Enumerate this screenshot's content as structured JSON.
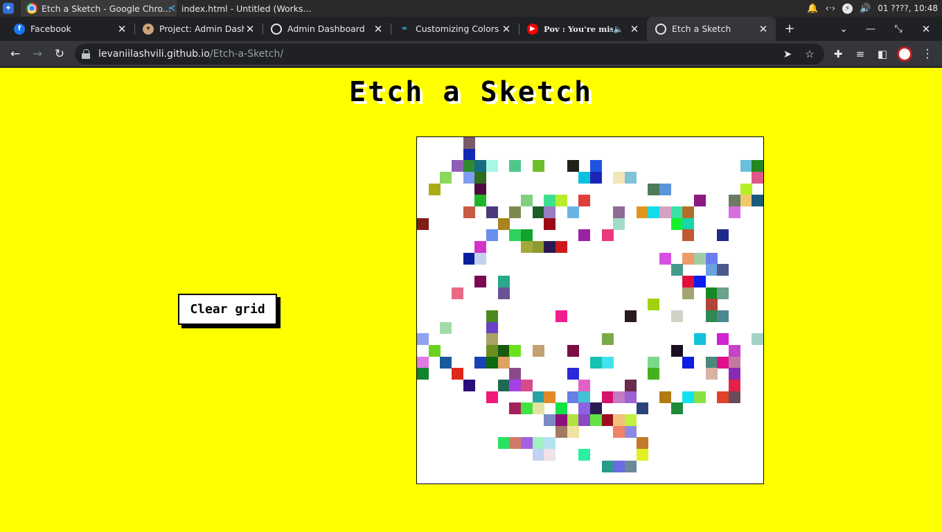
{
  "os": {
    "windows": [
      {
        "title": "Etch a Sketch - Google Chro...",
        "icon": "chrome-icon",
        "active": true
      },
      {
        "title": "index.html - Untitled (Works...",
        "icon": "vscode-icon",
        "active": false
      }
    ],
    "tray": {
      "datetime": "01 ????, 10:48"
    }
  },
  "browser": {
    "tabs": [
      {
        "title": "Facebook",
        "icon": "facebook-icon"
      },
      {
        "title": "Project: Admin Dashb",
        "icon": "project-icon"
      },
      {
        "title": "Admin Dashboard",
        "icon": "globe-icon"
      },
      {
        "title": "Customizing Colors - T",
        "icon": "tailwind-icon"
      },
      {
        "title": "Pov : You're misun",
        "icon": "youtube-icon"
      },
      {
        "title": "Etch a Sketch",
        "icon": "globe-icon",
        "active": true
      }
    ],
    "url": {
      "host": "levaniilashvili.github.io",
      "path": "/Etch-a-Sketch/"
    }
  },
  "page": {
    "title": "Etch a Sketch",
    "clear_button_label": "Clear grid",
    "background_color": "#ffff00",
    "grid": {
      "columns": 30,
      "rows": 30,
      "painted_cells": [
        [
          0,
          4,
          "#7b5a6b"
        ],
        [
          1,
          4,
          "#1328b5"
        ],
        [
          2,
          3,
          "#8e5eb6"
        ],
        [
          2,
          4,
          "#2e8b2f"
        ],
        [
          2,
          5,
          "#156b82"
        ],
        [
          2,
          6,
          "#a8f6e6"
        ],
        [
          2,
          8,
          "#4fc78b"
        ],
        [
          2,
          10,
          "#6dbe2b"
        ],
        [
          2,
          13,
          "#1e2218"
        ],
        [
          2,
          15,
          "#1e52e0"
        ],
        [
          2,
          28,
          "#6ac0da"
        ],
        [
          2,
          29,
          "#26861f"
        ],
        [
          3,
          2,
          "#8cd85d"
        ],
        [
          3,
          4,
          "#7e9cf2"
        ],
        [
          3,
          5,
          "#2e6c1e"
        ],
        [
          3,
          14,
          "#0ec0df"
        ],
        [
          3,
          15,
          "#1b26b6"
        ],
        [
          3,
          17,
          "#f0e6b6"
        ],
        [
          3,
          18,
          "#7ec3d8"
        ],
        [
          3,
          29,
          "#e0588a"
        ],
        [
          4,
          1,
          "#a8ad14"
        ],
        [
          4,
          5,
          "#4c0a41"
        ],
        [
          4,
          20,
          "#4f7a58"
        ],
        [
          4,
          21,
          "#5a95dc"
        ],
        [
          4,
          28,
          "#b6ef24"
        ],
        [
          5,
          5,
          "#1fb52a"
        ],
        [
          5,
          9,
          "#7fd07e"
        ],
        [
          5,
          11,
          "#3de08e"
        ],
        [
          5,
          12,
          "#b7ec2a"
        ],
        [
          5,
          14,
          "#e03e39"
        ],
        [
          5,
          24,
          "#8c1a82"
        ],
        [
          5,
          27,
          "#6a7c62"
        ],
        [
          5,
          28,
          "#f0c86e"
        ],
        [
          5,
          29,
          "#1b5a7c"
        ],
        [
          6,
          4,
          "#c95a44"
        ],
        [
          6,
          6,
          "#4a3a7c"
        ],
        [
          6,
          8,
          "#7c8a4e"
        ],
        [
          6,
          10,
          "#1d5c27"
        ],
        [
          6,
          11,
          "#9a7cc4"
        ],
        [
          6,
          13,
          "#6ab4e4"
        ],
        [
          6,
          17,
          "#8e6c96"
        ],
        [
          6,
          19,
          "#e0961e"
        ],
        [
          6,
          20,
          "#12dce8"
        ],
        [
          6,
          21,
          "#d4a2c2"
        ],
        [
          6,
          22,
          "#3ae0a6"
        ],
        [
          6,
          23,
          "#b06e2a"
        ],
        [
          6,
          27,
          "#d86ee0"
        ],
        [
          7,
          0,
          "#7e1e18"
        ],
        [
          7,
          7,
          "#a8841e"
        ],
        [
          7,
          11,
          "#9a0a12"
        ],
        [
          7,
          17,
          "#a2dcc8"
        ],
        [
          7,
          22,
          "#14f02a"
        ],
        [
          7,
          23,
          "#18d6a8"
        ],
        [
          8,
          6,
          "#6a8ef0"
        ],
        [
          8,
          8,
          "#2ed15c"
        ],
        [
          8,
          9,
          "#12a22e"
        ],
        [
          8,
          14,
          "#9a22a0"
        ],
        [
          8,
          16,
          "#ea3a7c"
        ],
        [
          8,
          23,
          "#c05a34"
        ],
        [
          8,
          26,
          "#1f2a8c"
        ],
        [
          9,
          5,
          "#d035c8"
        ],
        [
          9,
          9,
          "#a2aa36"
        ],
        [
          9,
          10,
          "#8e9a30"
        ],
        [
          9,
          11,
          "#2a1a52"
        ],
        [
          9,
          12,
          "#cc1a1a"
        ],
        [
          10,
          4,
          "#0d1e9c"
        ],
        [
          10,
          5,
          "#c2d2ee"
        ],
        [
          10,
          21,
          "#d550e2"
        ],
        [
          10,
          23,
          "#f09a6a"
        ],
        [
          10,
          24,
          "#a2cca6"
        ],
        [
          10,
          25,
          "#6a7ef2"
        ],
        [
          11,
          22,
          "#449a8a"
        ],
        [
          11,
          25,
          "#6aa2e0"
        ],
        [
          11,
          26,
          "#4a5a8c"
        ],
        [
          12,
          5,
          "#7c0a52"
        ],
        [
          12,
          7,
          "#2aa88a"
        ],
        [
          12,
          23,
          "#e00e3a"
        ],
        [
          12,
          24,
          "#0a1ef0"
        ],
        [
          13,
          3,
          "#e66a82"
        ],
        [
          13,
          7,
          "#6a5296"
        ],
        [
          13,
          23,
          "#a2a272"
        ],
        [
          13,
          25,
          "#158a22"
        ],
        [
          13,
          26,
          "#6aa28c"
        ],
        [
          14,
          20,
          "#a2d20e"
        ],
        [
          14,
          25,
          "#b04438"
        ],
        [
          15,
          6,
          "#4a8a1e"
        ],
        [
          15,
          12,
          "#f01e8e"
        ],
        [
          15,
          18,
          "#2a1a22"
        ],
        [
          15,
          22,
          "#d2d2c8"
        ],
        [
          15,
          25,
          "#2e8a52"
        ],
        [
          15,
          26,
          "#4a8a8e"
        ],
        [
          16,
          2,
          "#a2dca8"
        ],
        [
          16,
          6,
          "#6a42c8"
        ],
        [
          17,
          0,
          "#8ea2f0"
        ],
        [
          17,
          6,
          "#a8a266"
        ],
        [
          17,
          16,
          "#7aaa4a"
        ],
        [
          17,
          24,
          "#12c2d8"
        ],
        [
          17,
          26,
          "#d022d2"
        ],
        [
          17,
          29,
          "#a2d2c6"
        ],
        [
          18,
          1,
          "#6ad21e"
        ],
        [
          18,
          6,
          "#6a8e22"
        ],
        [
          18,
          7,
          "#1a5a0e"
        ],
        [
          18,
          8,
          "#6ae21e"
        ],
        [
          18,
          10,
          "#c2a272"
        ],
        [
          18,
          13,
          "#7c0e42"
        ],
        [
          18,
          22,
          "#1a0e22"
        ],
        [
          18,
          27,
          "#c842c8"
        ],
        [
          19,
          0,
          "#e07ae0"
        ],
        [
          19,
          2,
          "#1a5a9c"
        ],
        [
          19,
          5,
          "#1a42b2"
        ],
        [
          19,
          6,
          "#0e6a0e"
        ],
        [
          19,
          7,
          "#e0a262"
        ],
        [
          19,
          15,
          "#16c2b2"
        ],
        [
          19,
          16,
          "#42e2f0"
        ],
        [
          19,
          20,
          "#7ad88a"
        ],
        [
          19,
          23,
          "#0e1ee2"
        ],
        [
          19,
          25,
          "#4a8a7c"
        ],
        [
          19,
          26,
          "#e00e8a"
        ],
        [
          19,
          27,
          "#c27aa2"
        ],
        [
          20,
          0,
          "#12822e"
        ],
        [
          20,
          3,
          "#e0281a"
        ],
        [
          20,
          8,
          "#8a4a8a"
        ],
        [
          20,
          13,
          "#2a2ad8"
        ],
        [
          20,
          20,
          "#42b21e"
        ],
        [
          20,
          25,
          "#d8b2a2"
        ],
        [
          20,
          27,
          "#8a2ab2"
        ],
        [
          21,
          4,
          "#2a0e7a"
        ],
        [
          21,
          7,
          "#1e6a52"
        ],
        [
          21,
          8,
          "#a242e2"
        ],
        [
          21,
          9,
          "#d84a8a"
        ],
        [
          21,
          14,
          "#e062c8"
        ],
        [
          21,
          18,
          "#6a2a4a"
        ],
        [
          21,
          27,
          "#e2224a"
        ],
        [
          22,
          6,
          "#f01a7a"
        ],
        [
          22,
          10,
          "#2aa2a2"
        ],
        [
          22,
          11,
          "#e08a2a"
        ],
        [
          22,
          13,
          "#6a7ee8"
        ],
        [
          22,
          14,
          "#42c2d2"
        ],
        [
          22,
          16,
          "#d8126a"
        ],
        [
          22,
          17,
          "#c27ac2"
        ],
        [
          22,
          18,
          "#9a62d2"
        ],
        [
          22,
          21,
          "#b27a12"
        ],
        [
          22,
          23,
          "#12e2f0"
        ],
        [
          22,
          24,
          "#8ae242"
        ],
        [
          22,
          26,
          "#e2422a"
        ],
        [
          22,
          27,
          "#6a4a5a"
        ],
        [
          23,
          8,
          "#a2225a"
        ],
        [
          23,
          9,
          "#42e242"
        ],
        [
          23,
          10,
          "#e2e2a2"
        ],
        [
          23,
          12,
          "#12e242"
        ],
        [
          23,
          14,
          "#8a62e2"
        ],
        [
          23,
          15,
          "#2a1a52"
        ],
        [
          23,
          19,
          "#2a427a"
        ],
        [
          23,
          22,
          "#1e8a3a"
        ],
        [
          24,
          11,
          "#7a8ac2"
        ],
        [
          24,
          12,
          "#8a127a"
        ],
        [
          24,
          13,
          "#b2e242"
        ],
        [
          24,
          14,
          "#8a4ac2"
        ],
        [
          24,
          15,
          "#62e242"
        ],
        [
          24,
          16,
          "#9a0e1e"
        ],
        [
          24,
          17,
          "#f0c27a"
        ],
        [
          24,
          18,
          "#c2f042"
        ],
        [
          25,
          12,
          "#a27a62"
        ],
        [
          25,
          13,
          "#f0e2a2"
        ],
        [
          25,
          17,
          "#f0826a"
        ],
        [
          25,
          18,
          "#8a8ae2"
        ],
        [
          26,
          7,
          "#2ae262"
        ],
        [
          26,
          8,
          "#d27a6a"
        ],
        [
          26,
          9,
          "#a262e2"
        ],
        [
          26,
          10,
          "#a2f0c2"
        ],
        [
          26,
          11,
          "#b2e2f0"
        ],
        [
          26,
          19,
          "#c27a2a"
        ],
        [
          27,
          10,
          "#c2d2f0"
        ],
        [
          27,
          11,
          "#f0e2e8"
        ],
        [
          27,
          14,
          "#2af0a2"
        ],
        [
          27,
          19,
          "#e2f022"
        ],
        [
          28,
          16,
          "#2a9a8a"
        ],
        [
          28,
          17,
          "#6a6ae2"
        ],
        [
          28,
          18,
          "#6a8a9a"
        ]
      ]
    }
  }
}
